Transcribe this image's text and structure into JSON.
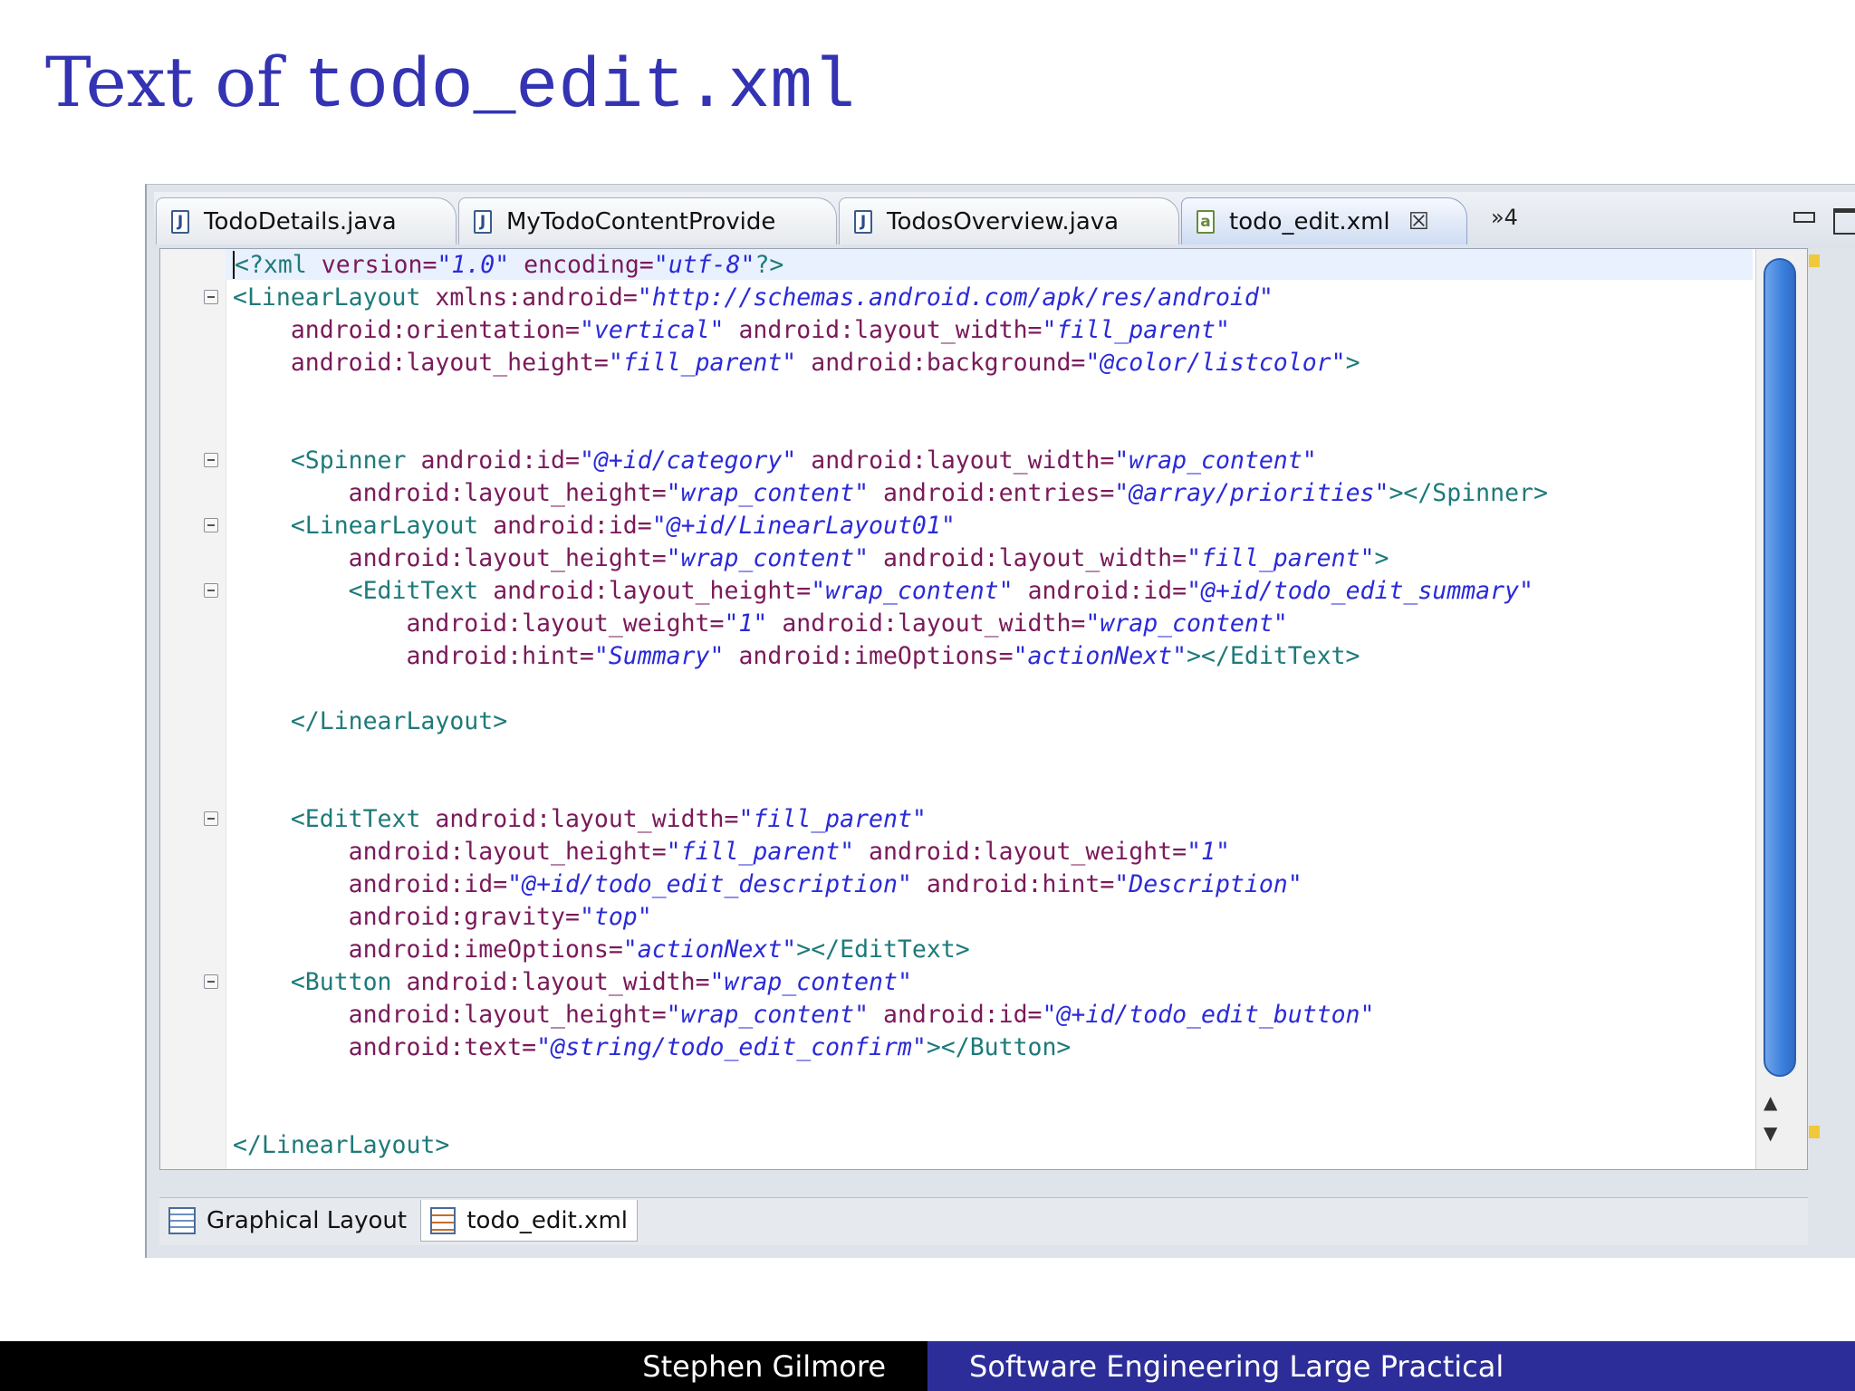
{
  "slide": {
    "title_prefix": "Text of ",
    "title_file": "todo_edit.xml"
  },
  "tabs": [
    {
      "label": "TodoDetails.java",
      "icon": "java-file-icon"
    },
    {
      "label": "MyTodoContentProvide",
      "icon": "java-file-icon"
    },
    {
      "label": "TodosOverview.java",
      "icon": "java-file-icon"
    },
    {
      "label": "todo_edit.xml",
      "icon": "xml-file-icon",
      "active": true
    }
  ],
  "overflow_tabs": "»4",
  "code": {
    "lines": [
      "<?xml version=\"1.0\" encoding=\"utf-8\"?>",
      "<LinearLayout xmlns:android=\"http://schemas.android.com/apk/res/android\"",
      "    android:orientation=\"vertical\" android:layout_width=\"fill_parent\"",
      "    android:layout_height=\"fill_parent\" android:background=\"@color/listcolor\">",
      "",
      "",
      "    <Spinner android:id=\"@+id/category\" android:layout_width=\"wrap_content\"",
      "        android:layout_height=\"wrap_content\" android:entries=\"@array/priorities\"></Spinner>",
      "    <LinearLayout android:id=\"@+id/LinearLayout01\"",
      "        android:layout_height=\"wrap_content\" android:layout_width=\"fill_parent\">",
      "        <EditText android:layout_height=\"wrap_content\" android:id=\"@+id/todo_edit_summary\"",
      "            android:layout_weight=\"1\" android:layout_width=\"wrap_content\"",
      "            android:hint=\"Summary\" android:imeOptions=\"actionNext\"></EditText>",
      "",
      "    </LinearLayout>",
      "",
      "",
      "    <EditText android:layout_width=\"fill_parent\"",
      "        android:layout_height=\"fill_parent\" android:layout_weight=\"1\"",
      "        android:id=\"@+id/todo_edit_description\" android:hint=\"Description\"",
      "        android:gravity=\"top\"",
      "        android:imeOptions=\"actionNext\"></EditText>",
      "    <Button android:layout_width=\"wrap_content\"",
      "        android:layout_height=\"wrap_content\" android:id=\"@+id/todo_edit_button\"",
      "        android:text=\"@string/todo_edit_confirm\"></Button>",
      "",
      "",
      "</LinearLayout>"
    ],
    "fold_lines": [
      1,
      6,
      8,
      10,
      17,
      22
    ]
  },
  "bottom_tabs": [
    {
      "label": "Graphical Layout",
      "icon": "layout-icon"
    },
    {
      "label": "todo_edit.xml",
      "icon": "xml-source-icon",
      "active": true
    }
  ],
  "footer": {
    "author": "Stephen Gilmore",
    "course": "Software Engineering Large Practical"
  },
  "colors": {
    "title": "#3333b3",
    "tag": "#1e7a7a",
    "attribute": "#7a1a5a",
    "value": "#2a2ad8",
    "footer_right": "#2d2d9a"
  }
}
